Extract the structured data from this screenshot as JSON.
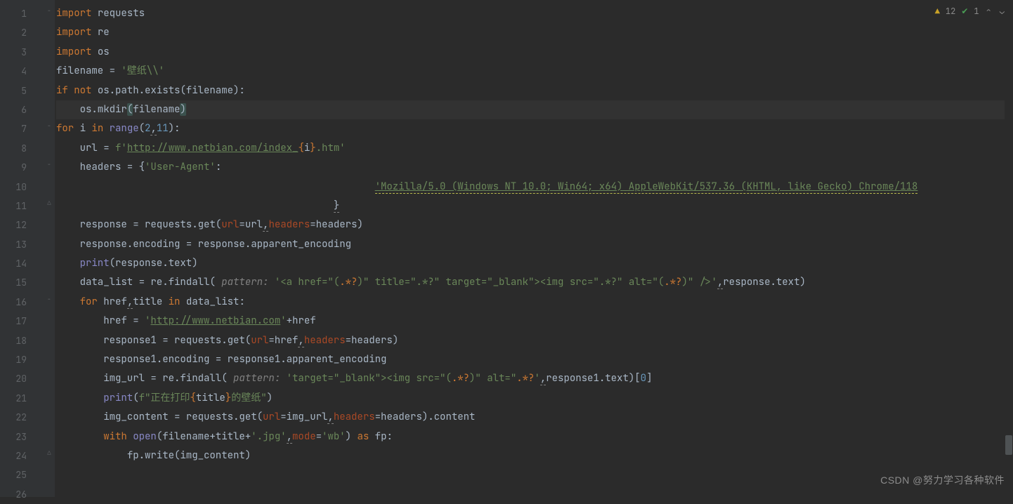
{
  "status": {
    "warning_icon": "▲",
    "warning_count": "12",
    "check_icon": "✔",
    "check_count": "1",
    "up": "⌃",
    "down": "⌄"
  },
  "watermark": "CSDN @努力学习各种软件",
  "gutter": {
    "start": 1,
    "end": 26
  },
  "code": {
    "l1": {
      "kw1": "import",
      "sp": " ",
      "id": "requests"
    },
    "l2": {
      "kw1": "import",
      "sp": " ",
      "id": "re"
    },
    "l3": {
      "kw1": "import",
      "sp": " ",
      "id": "os"
    },
    "l4": {
      "id": "filename = ",
      "str": "'壁纸\\\\'"
    },
    "l5": {
      "kw1": "if ",
      "kw2": "not ",
      "rest": "os.path.exists(filename):"
    },
    "l6": {
      "indent": "    ",
      "rest1": "os.mkdir",
      "paren_o": "(",
      "arg": "filename",
      "paren_c": ")"
    },
    "l7": {
      "kw1": "for ",
      "id1": "i ",
      "kw2": "in ",
      "fn": "range",
      "rest": "(",
      "n1": "2",
      "comma": ",",
      "n2": "11",
      "close": "):"
    },
    "l8": {
      "indent": "    ",
      "lhs": "url = ",
      "fpre": "f'",
      "url": "http://www.netbian.com/index_",
      "brace_o": "{",
      "var": "i",
      "brace_c": "}",
      "tail": ".htm'"
    },
    "l9": {
      "indent": "    ",
      "lhs": "headers = {",
      "key": "'User-Agent'",
      "colon": ":"
    },
    "l10": {
      "indent": "                                                      ",
      "ua": "'Mozilla/5.0 (Windows NT 10.0; Win64; x64) AppleWebKit/537.36 (KHTML, like Gecko) Chrome/118"
    },
    "l11": {
      "indent": "                                               ",
      "brace": "}"
    },
    "l12": {
      "indent": "    ",
      "pre": "response = requests.get(",
      "k1": "url",
      "eq1": "=url",
      "c": ",",
      "k2": "headers",
      "eq2": "=headers)"
    },
    "l13": {
      "indent": "    ",
      "txt": "response.encoding = response.apparent_encoding"
    },
    "l14": {
      "indent": "    ",
      "fn": "print",
      "rest": "(response.text)"
    },
    "l15": {
      "indent": "    ",
      "pre": "data_list = re.findall( ",
      "param": "pattern: ",
      "str1": "'<a href=\"(",
      "grp1": ".*?",
      "str2": ")\" title=\".*?\" target=\"_blank\"><img src=\".*?\" alt=\"(",
      "grp2": ".*?",
      "str3": ")\" />'",
      "c": ",",
      "tail": "response.text)"
    },
    "l16": {
      "indent": "    ",
      "kw1": "for ",
      "ids": "href",
      "c0": ",",
      "ids2": "title ",
      "kw2": "in ",
      "rest": "data_list:"
    },
    "l17": {
      "indent": "        ",
      "pre": "href = ",
      "q": "'",
      "url": "http://www.netbian.com",
      "q2": "'",
      "plus": "+href"
    },
    "l18": {
      "indent": "        ",
      "pre": "response1 = requests.get(",
      "k1": "url",
      "eq1": "=href",
      "c": ",",
      "k2": "headers",
      "eq2": "=headers)"
    },
    "l19": {
      "indent": "        ",
      "txt": "response1.encoding = response1.apparent_encoding"
    },
    "l20": {
      "indent": "        ",
      "pre": "img_url = re.findall( ",
      "param": "pattern: ",
      "str1": "'target=\"_blank\"><img src=\"(",
      "grp1": ".*?",
      "str2": ")\" alt=\"",
      "grp2": ".*?",
      "str3": "'",
      "c": ",",
      "tail": "response1.text)[",
      "idx": "0",
      "close": "]"
    },
    "l21": {
      "indent": "        ",
      "fn": "print",
      "po": "(",
      "f": "f\"",
      "s1": "正在打印",
      "bo": "{",
      "v": "title",
      "bc": "}",
      "s2": "的壁纸\"",
      ")": ")"
    },
    "l22": {
      "indent": "        ",
      "pre": "img_content = requests.get(",
      "k1": "url",
      "eq1": "=img_url",
      "c": ",",
      "k2": "headers",
      "eq2": "=headers).content"
    },
    "l23": {
      "indent": "        ",
      "kw": "with ",
      "fn": "open",
      "po": "(filename+title+",
      "str": "'.jpg'",
      "c": ",",
      "k": "mode",
      "eq": "=",
      "str2": "'wb'",
      "pc": ") ",
      "kw2": "as ",
      "id": "fp:"
    },
    "l24": {
      "indent": "            ",
      "txt": "fp.write(img_content)"
    }
  }
}
